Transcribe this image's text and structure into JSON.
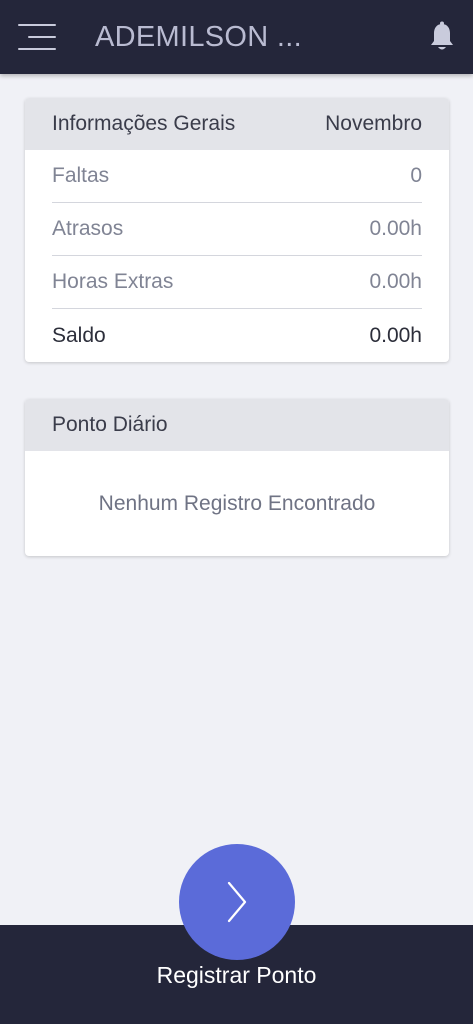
{
  "header": {
    "title": "ADEMILSON ...",
    "menu_icon": "hamburger-menu-icon",
    "notification_icon": "bell-icon"
  },
  "general_info": {
    "title": "Informações Gerais",
    "month": "Novembro",
    "rows": [
      {
        "label": "Faltas",
        "value": "0"
      },
      {
        "label": "Atrasos",
        "value": "0.00h"
      },
      {
        "label": "Horas Extras",
        "value": "0.00h"
      },
      {
        "label": "Saldo",
        "value": "0.00h"
      }
    ]
  },
  "daily": {
    "title": "Ponto Diário",
    "empty_message": "Nenhum Registro Encontrado"
  },
  "footer": {
    "action_label": "Registrar Ponto",
    "action_icon": "chevron-right-icon"
  },
  "colors": {
    "bar_background": "#24263a",
    "page_background": "#f0f1f6",
    "accent": "#5b6bd9"
  }
}
